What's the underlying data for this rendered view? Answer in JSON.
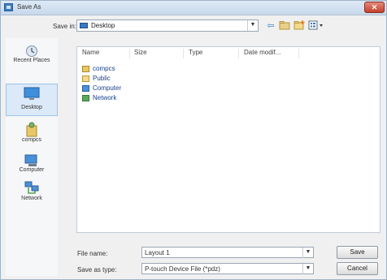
{
  "window": {
    "title": "Save As"
  },
  "toolbar": {
    "save_in_label": "Save in:",
    "location": "Desktop"
  },
  "places": [
    {
      "label": "Recent Places",
      "icon": "recent-places-icon"
    },
    {
      "label": "Desktop",
      "icon": "desktop-icon"
    },
    {
      "label": "compcs",
      "icon": "user-folder-icon"
    },
    {
      "label": "Computer",
      "icon": "computer-icon"
    },
    {
      "label": "Network",
      "icon": "network-icon"
    }
  ],
  "list": {
    "columns": [
      "Name",
      "Size",
      "Type",
      "Date modif..."
    ],
    "items": [
      {
        "name": "compcs",
        "icon": "user-folder-icon"
      },
      {
        "name": "Public",
        "icon": "folder-icon"
      },
      {
        "name": "Computer",
        "icon": "computer-icon"
      },
      {
        "name": "Network",
        "icon": "network-icon"
      }
    ]
  },
  "form": {
    "filename_label": "File name:",
    "filename_value": "Layout 1",
    "type_label": "Save as type:",
    "type_value": "P-touch Device File (*pdz)",
    "save_label": "Save",
    "cancel_label": "Cancel"
  }
}
